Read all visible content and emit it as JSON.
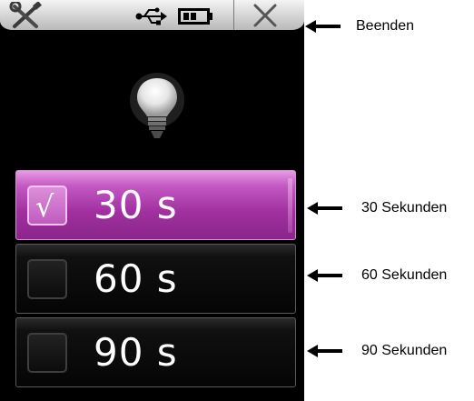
{
  "header": {
    "icons": [
      "tools-icon",
      "usb-icon",
      "battery-icon",
      "close-icon"
    ]
  },
  "content": {
    "icon": "light-bulb-icon"
  },
  "options": [
    {
      "label": "30 s",
      "checked": true,
      "checkmark": "√"
    },
    {
      "label": "60 s",
      "checked": false,
      "checkmark": ""
    },
    {
      "label": "90 s",
      "checked": false,
      "checkmark": ""
    }
  ],
  "annotations": {
    "beenden": "Beenden",
    "sec30": "30 Sekunden",
    "sec60": "60 Sekunden",
    "sec90": "90 Sekunden"
  },
  "colors": {
    "selected_accent": "#a0309f",
    "background": "#000000",
    "header": "#d9d9d9"
  }
}
